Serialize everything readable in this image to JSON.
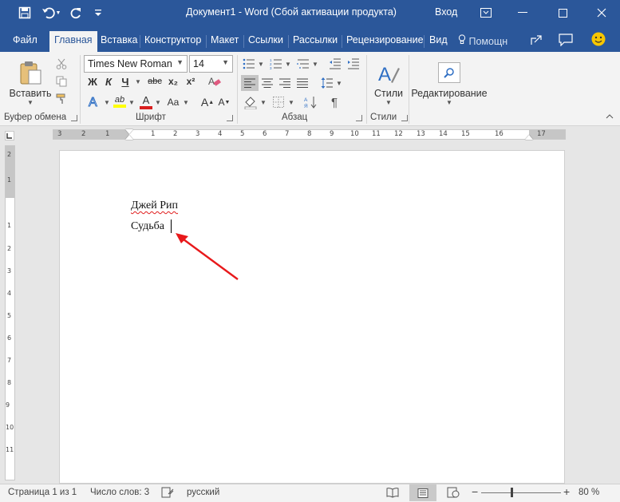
{
  "titlebar": {
    "title": "Документ1  -  Word (Сбой активации продукта)",
    "signin": "Вход",
    "bg_color": "#2b579a"
  },
  "quick_access": [
    "save-icon",
    "undo-icon",
    "redo-icon",
    "customize-icon"
  ],
  "tabs": [
    {
      "label": "Файл"
    },
    {
      "label": "Главная",
      "active": true
    },
    {
      "label": "Вставка"
    },
    {
      "label": "Конструктор"
    },
    {
      "label": "Макет"
    },
    {
      "label": "Ссылки"
    },
    {
      "label": "Рассылки"
    },
    {
      "label": "Рецензирование"
    },
    {
      "label": "Вид"
    },
    {
      "label": "Помощн"
    }
  ],
  "ribbon": {
    "clipboard": {
      "paste_label": "Вставить",
      "group_label": "Буфер обмена"
    },
    "font": {
      "font_name": "Times New Roman",
      "font_size": "14",
      "bold": "Ж",
      "italic": "К",
      "underline": "Ч",
      "strikethrough": "abc",
      "subscript": "x₂",
      "superscript": "x²",
      "change_case": "Aa",
      "grow": "A",
      "shrink": "A",
      "highlight": "ab",
      "font_color": "A",
      "group_label": "Шрифт"
    },
    "paragraph": {
      "group_label": "Абзац",
      "show_marks": "¶"
    },
    "styles": {
      "styles_label": "Стили",
      "group_label": "Стили"
    },
    "editing": {
      "label": "Редактирование"
    }
  },
  "document": {
    "lines": [
      "Джей Рип",
      "Судьба"
    ]
  },
  "statusbar": {
    "page": "Страница 1 из 1",
    "words": "Число слов: 3",
    "language": "русский",
    "zoom": "80 %",
    "zoom_minus": "−",
    "zoom_plus": "+"
  },
  "ruler": {
    "h_labels": [
      "3",
      "2",
      "1",
      "1",
      "2",
      "3",
      "4",
      "5",
      "6",
      "7",
      "8",
      "9",
      "10",
      "11",
      "12",
      "13",
      "14",
      "15",
      "16",
      "17"
    ],
    "v_labels": [
      "2",
      "1",
      "1",
      "2",
      "3",
      "4",
      "5",
      "6",
      "7",
      "8",
      "9",
      "10",
      "11"
    ]
  },
  "annotation": {
    "color": "#e8191b"
  }
}
